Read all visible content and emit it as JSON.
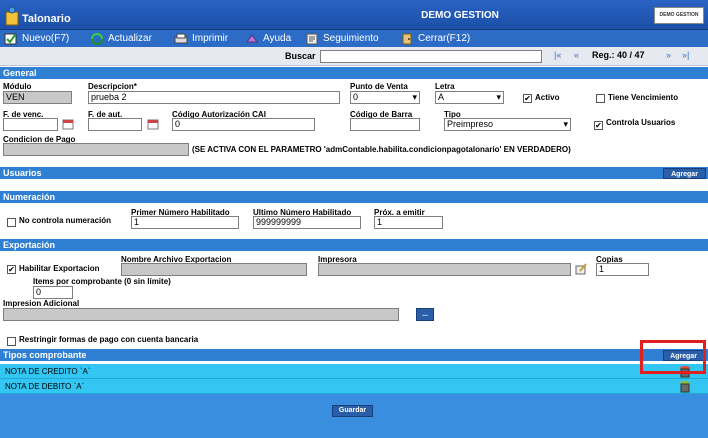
{
  "title_bar": {
    "app_title": "Talonario",
    "company": "DEMO GESTION",
    "logo_text": "DEMO GESTION"
  },
  "toolbar": {
    "items": [
      {
        "label": "Nuevo(F7)",
        "icon": "new-icon"
      },
      {
        "label": "Actualizar",
        "icon": "refresh-icon"
      },
      {
        "label": "Imprimir",
        "icon": "print-icon"
      },
      {
        "label": "Ayuda",
        "icon": "help-icon"
      },
      {
        "label": "Seguimiento",
        "icon": "tracking-icon"
      },
      {
        "label": "Cerrar(F12)",
        "icon": "close-icon"
      }
    ]
  },
  "search": {
    "label": "Buscar",
    "value": "",
    "first": "|«",
    "prev": "«",
    "reg_label": "Reg.: 40 / 47",
    "next": "»",
    "last": "»|"
  },
  "general": {
    "header": "General",
    "modulo_label": "Módulo",
    "modulo_value": "VEN",
    "descripcion_label": "Descripcion*",
    "descripcion_value": "prueba 2",
    "punto_venta_label": "Punto de Venta",
    "punto_venta_value": "0",
    "letra_label": "Letra",
    "letra_value": "A",
    "activo_label": "Activo",
    "activo_checked": "✔",
    "tiene_venc_label": "Tiene Vencimiento",
    "f_venc_label": "F. de venc.",
    "f_venc_value": "",
    "f_aut_label": "F. de aut.",
    "f_aut_value": "",
    "cai_label": "Código Autorización CAI",
    "cai_value": "0",
    "codigo_barra_label": "Código de Barra",
    "codigo_barra_value": "",
    "tipo_label": "Tipo",
    "tipo_value": "Preimpreso",
    "controla_usuarios_label": "Controla Usuarios",
    "controla_usuarios_checked": "✔",
    "condicion_pago_label": "Condicion de Pago",
    "condicion_pago_value": "",
    "condicion_note": "(SE ACTIVA CON EL PARAMETRO 'admContable.habilita.condicionpagotalonario' EN VERDADERO)"
  },
  "usuarios": {
    "header": "Usuarios",
    "add_label": "Agregar"
  },
  "numeracion": {
    "header": "Numeración",
    "no_controla_label": "No controla numeración",
    "primer_label": "Primer Número Habilitado",
    "primer_value": "1",
    "ultimo_label": "Ultimo Número Habilitado",
    "ultimo_value": "999999999",
    "prox_label": "Próx. a emitir",
    "prox_value": "1"
  },
  "exportacion": {
    "header": "Exportación",
    "habilitar_label": "Habilitar Exportacion",
    "habilitar_checked": "✔",
    "archivo_label": "Nombre Archivo Exportacion",
    "archivo_value": "",
    "impresora_label": "Impresora",
    "impresora_value": "",
    "copias_label": "Copias",
    "copias_value": "1",
    "items_label": "Items por comprobante (0 sin límite)",
    "items_value": "0",
    "impresion_adicional_label": "Impresion Adicional",
    "impresion_adicional_value": "",
    "browse_label": "...",
    "restringir_label": "Restringir formas de pago con cuenta bancaria"
  },
  "tipos": {
    "header": "Tipos comprobante",
    "add_label": "Agregar",
    "rows": [
      {
        "label": "NOTA DE CREDITO `A`"
      },
      {
        "label": "NOTA DE DEBITO `A`"
      }
    ]
  },
  "footer": {
    "save_label": "Guardar"
  },
  "colors": {
    "section_header": "#2f7fd3",
    "row_highlight": "#33c6f2",
    "annotation": "#e01f1f"
  }
}
